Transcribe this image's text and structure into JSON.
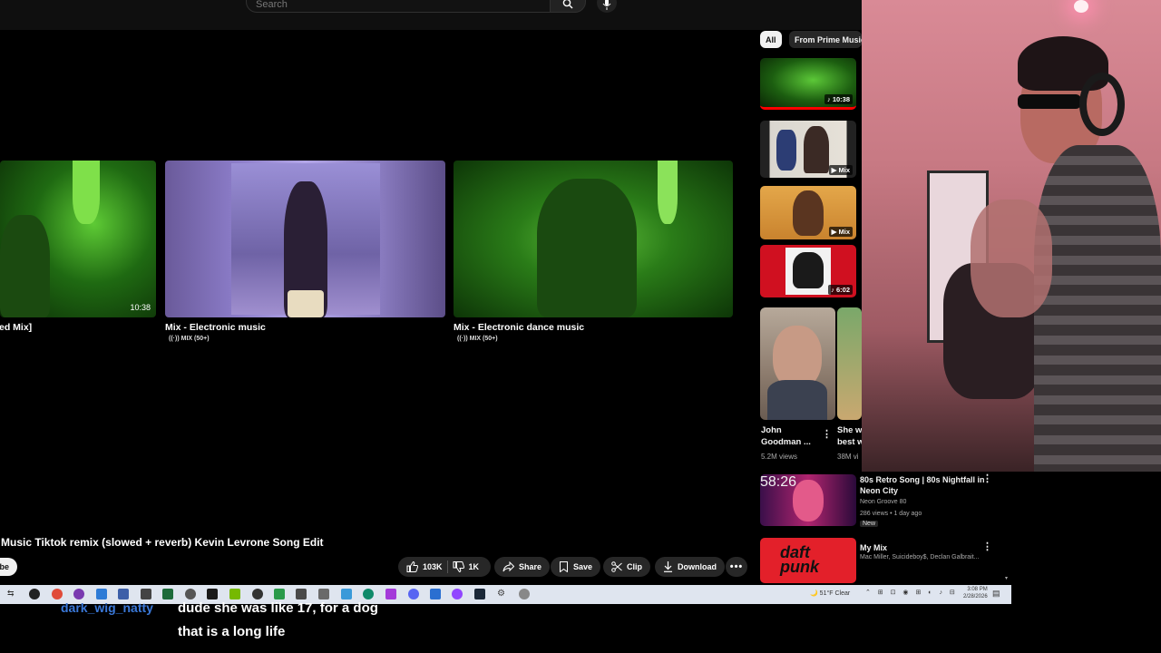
{
  "search": {
    "placeholder": "Search"
  },
  "player": {
    "endcards": [
      {
        "title": "ed Mix]",
        "duration": "10:38",
        "subtitle": ""
      },
      {
        "title": "Mix - Electronic music",
        "subtitle": "MIX (50+)"
      },
      {
        "title": "Mix - Electronic dance music",
        "subtitle": "MIX (50+)"
      }
    ]
  },
  "video": {
    "title": "Music Tiktok remix (slowed + reverb) Kevin Levrone Song Edit",
    "subscribe_label": "be",
    "like_count": "103K",
    "dislike_count": "1K",
    "share_label": "Share",
    "save_label": "Save",
    "clip_label": "Clip",
    "download_label": "Download"
  },
  "chips": {
    "all": "All",
    "prime": "From Prime Music"
  },
  "sidebar_thumbs": [
    {
      "badge": "10:38",
      "icon": "music-note-icon"
    },
    {
      "badge": "Mix",
      "icon": "play-icon"
    },
    {
      "badge": "Mix",
      "icon": "play-icon"
    },
    {
      "badge": "6:02",
      "icon": "music-note-icon"
    }
  ],
  "shorts": [
    {
      "title_line1": "John",
      "title_line2": "Goodman ...",
      "views": "5.2M views"
    },
    {
      "title_line1": "She w",
      "title_line2": "best w",
      "views": "38M vi"
    }
  ],
  "recommendations": [
    {
      "title_line1": "80s Retro Song | 80s Nightfall in",
      "title_line2": "Neon City",
      "channel": "Neon Groove 80",
      "meta": "286 views • 1 day ago",
      "badge": "New",
      "duration": "58:26"
    },
    {
      "title_line1": "My Mix",
      "title_line2": "",
      "channel": "Mac Miller, Suicideboy$, Declan Galbrait...",
      "meta": "",
      "badge": "",
      "duration": ""
    }
  ],
  "taskbar": {
    "weather": "51°F  Clear",
    "time": "3:08 PM",
    "date": "2/28/2026"
  },
  "chat": {
    "username": "dark_wig_natty",
    "message_line1": "dude she was like 17, for a dog",
    "message_line2": "that is a long life"
  },
  "colors": {
    "accent_red": "#ff0000",
    "chat_username": "#3a78d8",
    "pill_bg": "#272727",
    "taskbar_bg": "#dfe5ef"
  }
}
